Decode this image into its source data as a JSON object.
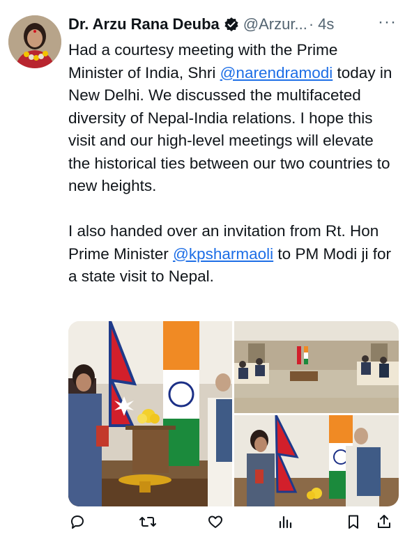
{
  "tweet": {
    "author_name": "Dr. Arzu Rana Deuba",
    "handle": "@Arzur...",
    "separator": "·",
    "time": "4s",
    "more_label": "···",
    "text_line1": "Had a courtesy meeting with the Prime Minister of India, Shri ",
    "mention1": "@narendramodi",
    "text_line1b": " today in New Delhi. We discussed the multifaceted diversity of Nepal-India relations. I hope this visit and our high-level meetings will elevate the historical ties between our two countries to new heights.",
    "text_line2": "I also handed over an invitation from Rt. Hon Prime Minister ",
    "mention2": "@kpsharmaoli",
    "text_line2b": " to PM Modi ji for a state visit to Nepal."
  },
  "actions": [
    {
      "name": "reply",
      "icon": "comment-icon"
    },
    {
      "name": "retweet",
      "icon": "retweet-icon"
    },
    {
      "name": "like",
      "icon": "heart-icon"
    },
    {
      "name": "views",
      "icon": "bar-chart-icon"
    },
    {
      "name": "bookmark",
      "icon": "bookmark-icon"
    },
    {
      "name": "share",
      "icon": "share-icon"
    }
  ],
  "colors": {
    "accent": "#1d9bf0",
    "mention": "#1d6ee6",
    "muted": "#536471",
    "text": "#0f1419"
  }
}
